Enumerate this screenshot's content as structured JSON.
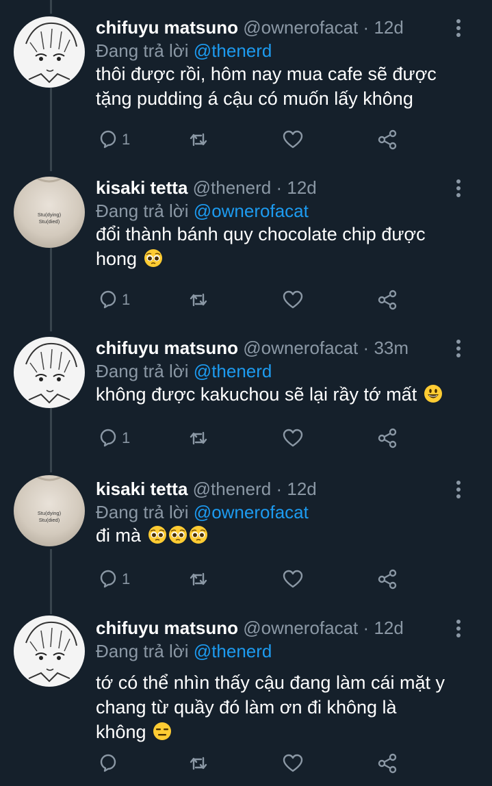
{
  "tweets": [
    {
      "avatar": "chifuyu",
      "name": "chifuyu matsuno",
      "handle": "@ownerofacat",
      "time": "12d",
      "reply_prefix": "Đang trả lời",
      "reply_to": "@thenerd",
      "lines": [
        "thôi được rồi, hôm nay mua cafe sẽ được",
        "tặng pudding á cậu có muốn lấy không"
      ],
      "emoji": [],
      "reply_count": "1"
    },
    {
      "avatar": "kisaki",
      "name": "kisaki tetta",
      "handle": "@thenerd",
      "time": "12d",
      "reply_prefix": "Đang trả lời",
      "reply_to": "@ownerofacat",
      "lines": [
        "đổi thành bánh quy chocolate chip được",
        "hong"
      ],
      "emoji": [
        "pleading-face-emoji"
      ],
      "reply_count": "1"
    },
    {
      "avatar": "chifuyu",
      "name": "chifuyu matsuno",
      "handle": "@ownerofacat",
      "time": "33m",
      "reply_prefix": "Đang trả lời",
      "reply_to": "@thenerd",
      "lines": [
        "không được kakuchou sẽ lại rầy tớ mất"
      ],
      "emoji": [
        "grinning-face-emoji"
      ],
      "reply_count": "1"
    },
    {
      "avatar": "kisaki",
      "name": "kisaki tetta",
      "handle": "@thenerd",
      "time": "12d",
      "reply_prefix": "Đang trả lời",
      "reply_to": "@ownerofacat",
      "lines": [
        "đi mà"
      ],
      "emoji": [
        "pleading-face-emoji",
        "pleading-face-emoji",
        "pleading-face-emoji"
      ],
      "reply_count": "1"
    },
    {
      "avatar": "chifuyu",
      "name": "chifuyu matsuno",
      "handle": "@ownerofacat",
      "time": "12d",
      "reply_prefix": "Đang trả lời",
      "reply_to": "@thenerd",
      "lines": [
        "tớ có thể nhìn thấy cậu đang làm cái mặt y",
        "chang từ quầy đó làm ơn đi không là",
        "không"
      ],
      "emoji": [
        "expressionless-face-emoji"
      ],
      "reply_count": ""
    }
  ],
  "avatar_shirt_text": [
    "Stu(dying)",
    "Stu(died)"
  ],
  "colors": {
    "background": "#15202b",
    "muted": "#8b98a5",
    "mention": "#1d9bf0",
    "thread_line": "#38444d"
  },
  "icons": [
    "reply-icon",
    "retweet-icon",
    "like-icon",
    "share-icon",
    "more-icon"
  ]
}
